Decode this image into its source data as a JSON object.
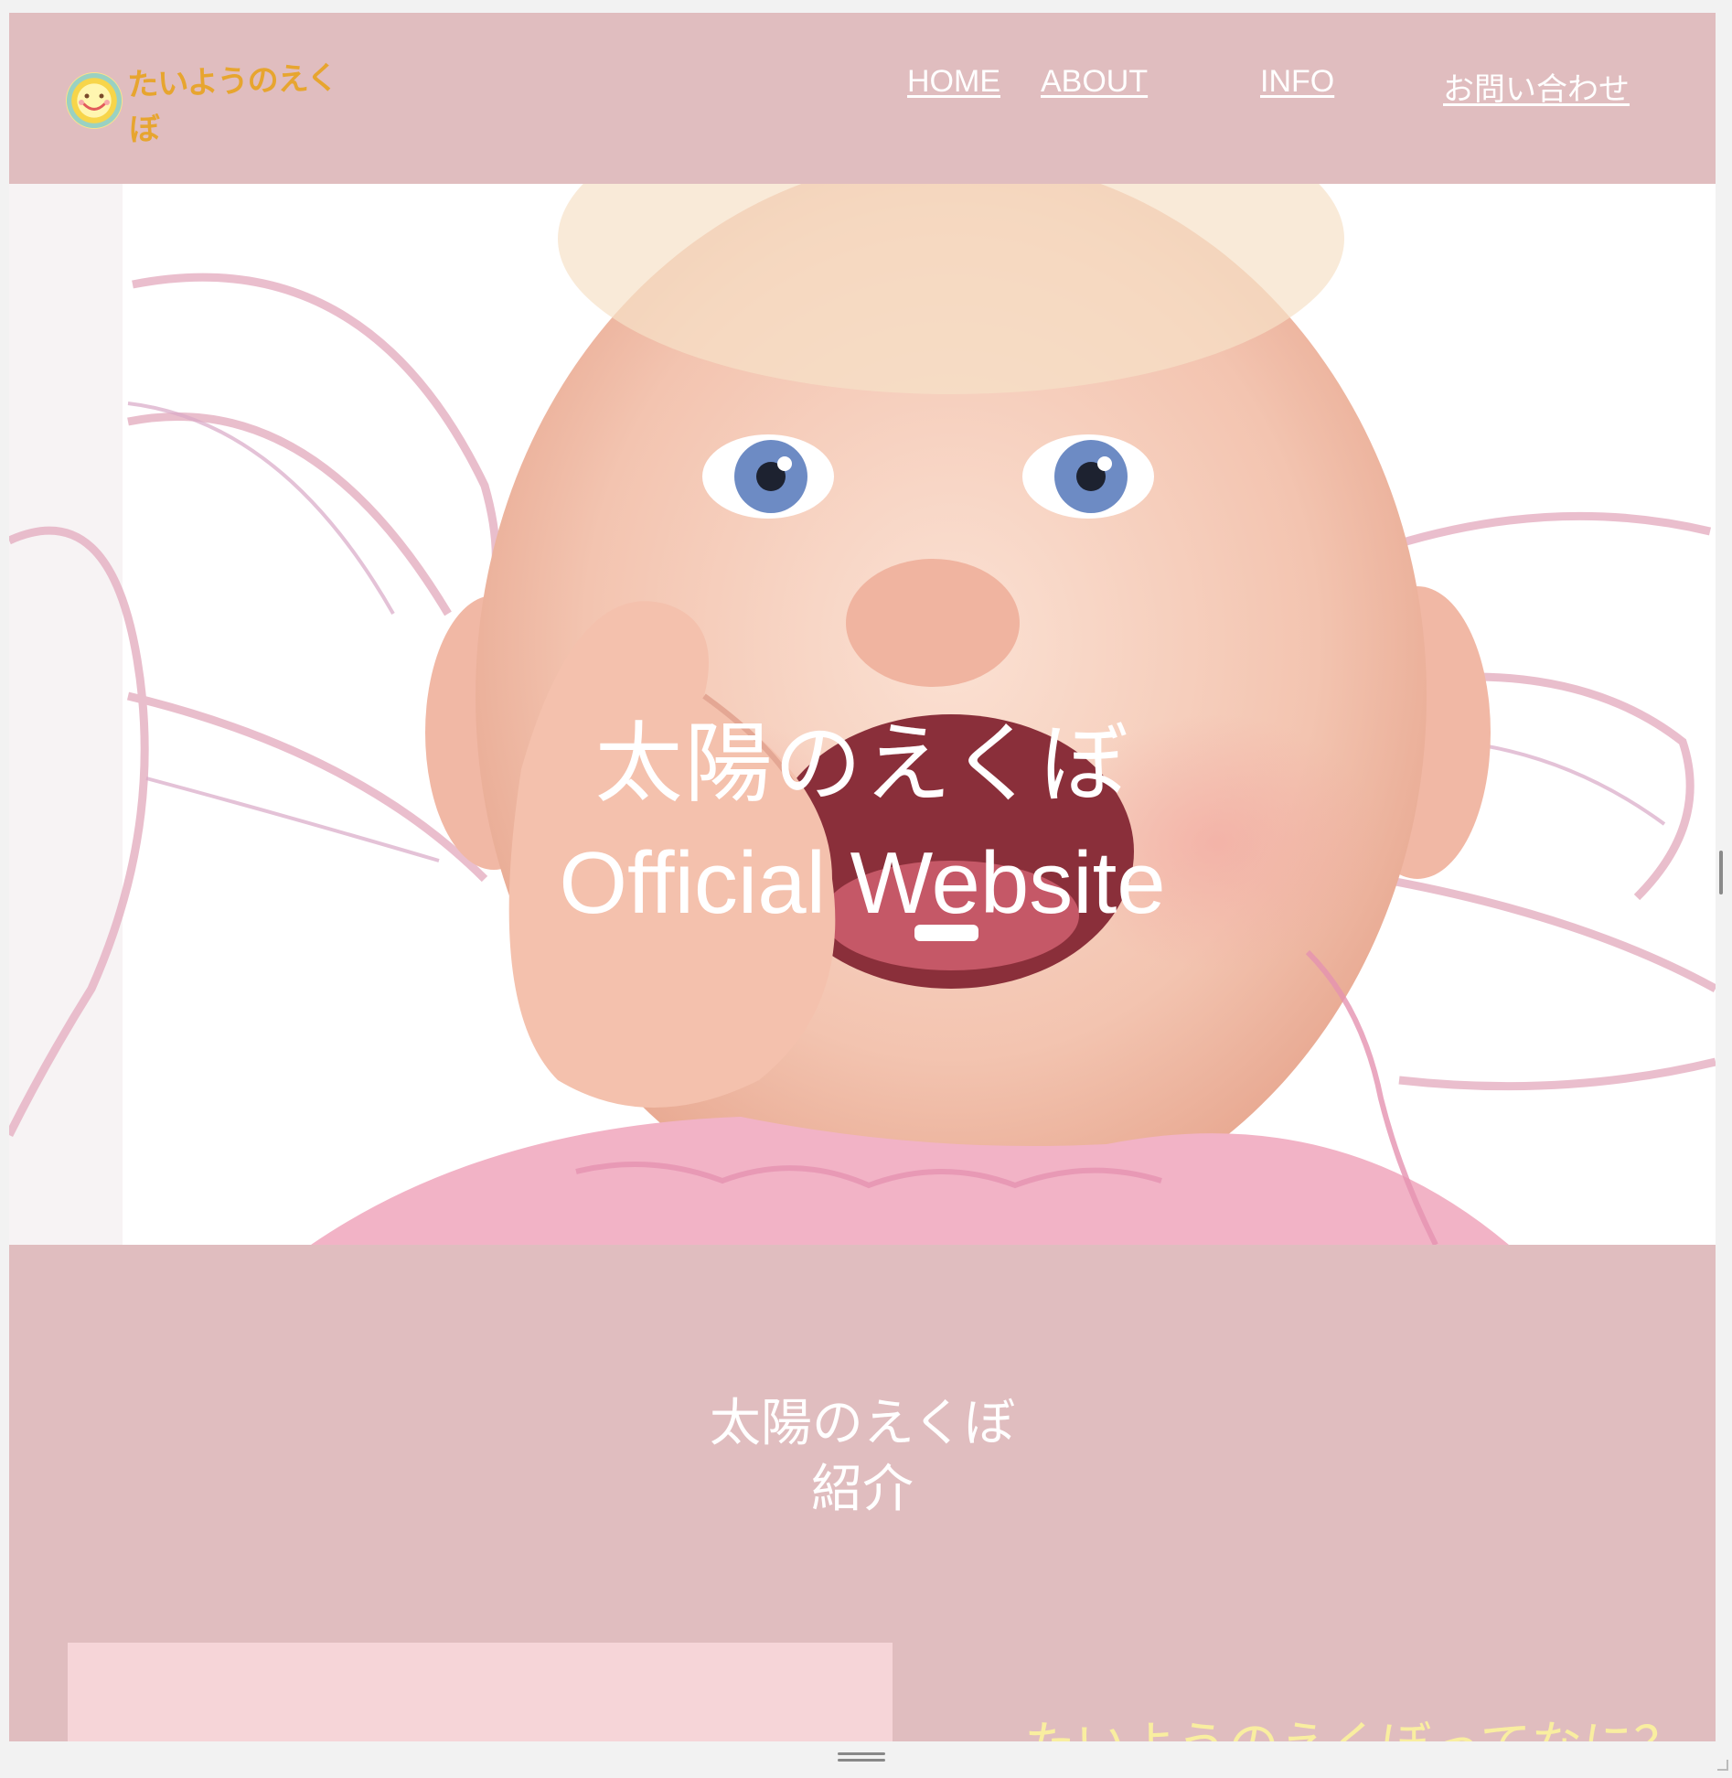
{
  "header": {
    "logo_text": "たいようのえくぼ",
    "nav": {
      "home": "HOME",
      "about": "ABOUT",
      "info": "INFO",
      "contact": "お問い合わせ"
    }
  },
  "hero": {
    "title": "太陽のえくぼ",
    "subtitle": "Official Website"
  },
  "intro": {
    "heading_line1": "太陽のえくぼ",
    "heading_line2": "紹介",
    "peek_text": "たいようのえくぼってなに？"
  },
  "colors": {
    "header_bg": "#e0bdbf",
    "card_bg": "#f6d5d8",
    "logo_text": "#e7a52f",
    "accent_yellow": "#f9eea0"
  }
}
